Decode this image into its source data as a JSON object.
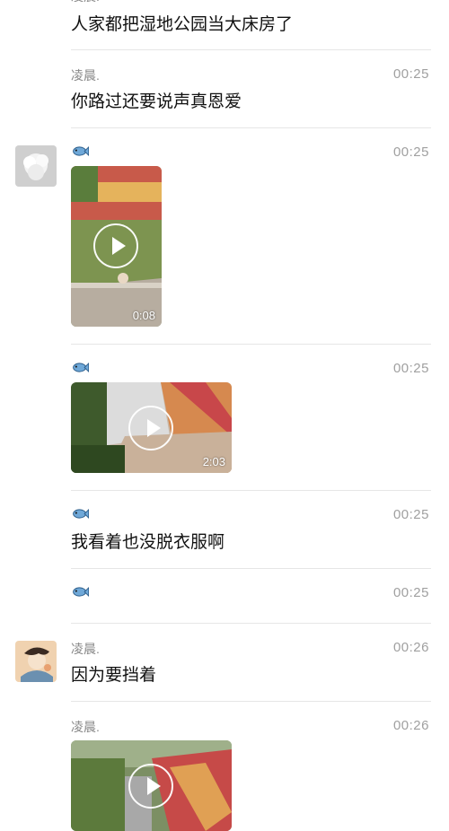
{
  "messages": [
    {
      "text": "人家都把湿地公园当大床房了"
    },
    {
      "name": "凌晨.",
      "time": "00:25",
      "text": "你路过还要说声真恩爱"
    },
    {
      "name_icon": "fish-icon",
      "time": "00:25",
      "video_duration": "0:08"
    },
    {
      "name_icon": "fish-icon",
      "time": "00:25",
      "video_duration": "2:03"
    },
    {
      "name_icon": "fish-icon",
      "time": "00:25",
      "text": "我看着也没脱衣服啊"
    },
    {
      "name_icon": "fish-icon",
      "time": "00:25"
    },
    {
      "name": "凌晨.",
      "time": "00:26",
      "text": "因为要挡着"
    },
    {
      "name": "凌晨.",
      "time": "00:26",
      "video_duration": ""
    }
  ],
  "colors": {
    "separator": "#e6e6e6",
    "timestamp": "#a0a0a0",
    "sender_name": "#888888"
  }
}
